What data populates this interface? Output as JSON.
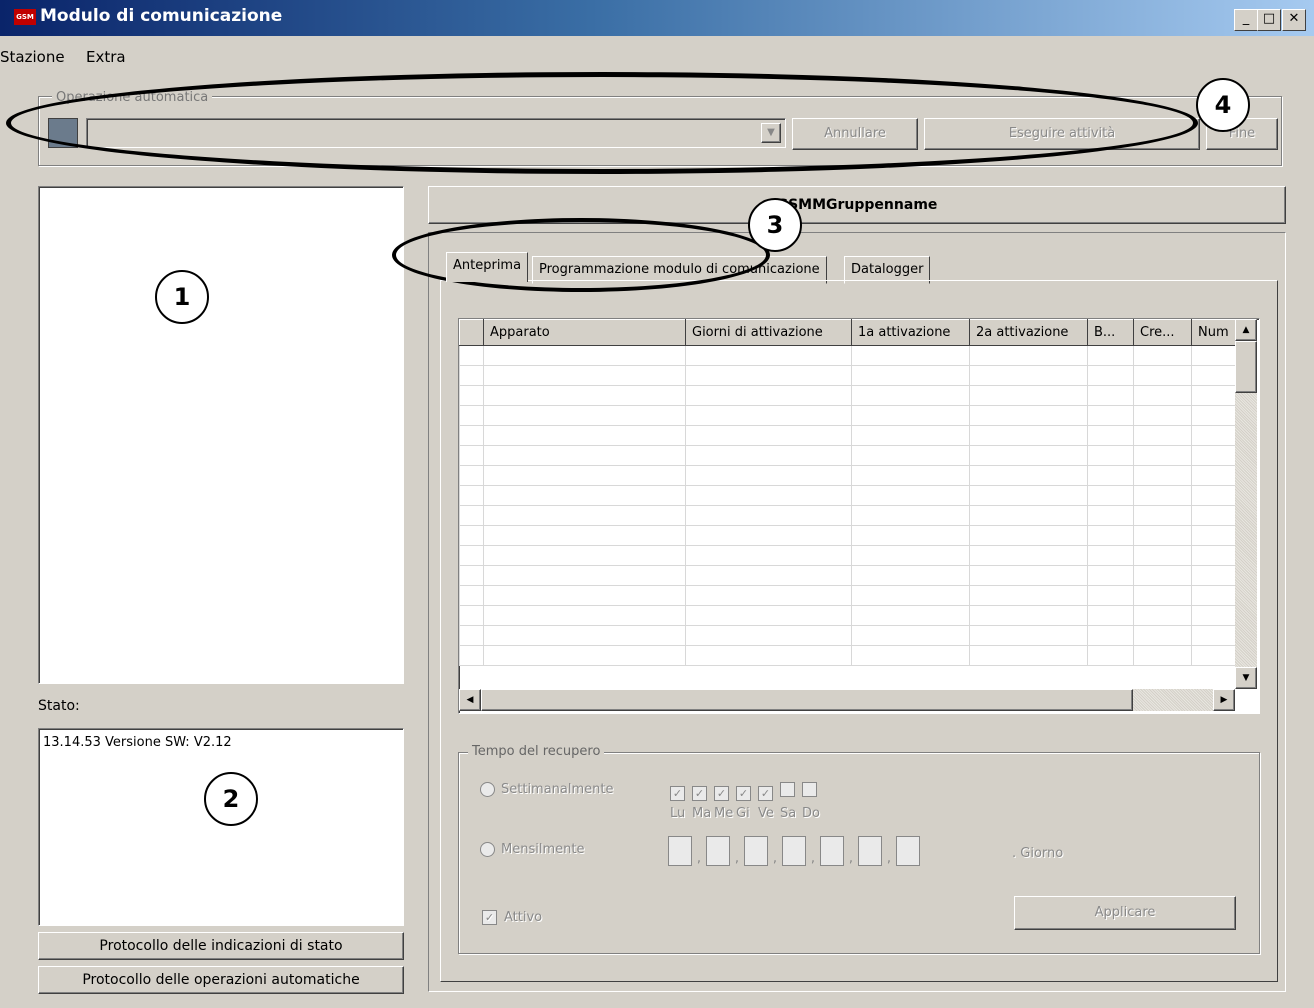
{
  "window": {
    "title": "Modulo di comunicazione",
    "icon_text": "GSM",
    "buttons": {
      "minimize": "_",
      "maximize": "□",
      "close": "✕"
    }
  },
  "menu": [
    "Stazione",
    "Extra"
  ],
  "auto_op": {
    "group_label": "Operazione automatica",
    "cancel_label": "Annullare",
    "execute_label": "Eseguire attività",
    "end_label": "Fine",
    "dropdown_value": ""
  },
  "left": {
    "status_label": "Stato:",
    "status_lines": [
      "13.14.53 Versione SW: V2.12"
    ],
    "btn_status_log": "Protocollo delle indicazioni di stato",
    "btn_auto_log": "Protocollo delle operazioni automatiche"
  },
  "right": {
    "group_name": "GSMMGruppenname",
    "tabs": [
      "Anteprima",
      "Programmazione modulo di comunicazione",
      "Datalogger"
    ],
    "active_tab": 0,
    "columns": [
      "",
      "Apparato",
      "Giorni di attivazione",
      "1a attivazione",
      "2a attivazione",
      "B...",
      "Cre...",
      "Num"
    ],
    "row_count": 16
  },
  "recovery": {
    "group_label": "Tempo del recupero",
    "weekly_label": "Settimanalmente",
    "monthly_label": "Mensilmente",
    "days": [
      "Lu",
      "Ma",
      "Me",
      "Gi",
      "Ve",
      "Sa",
      "Do"
    ],
    "days_checked": [
      true,
      true,
      true,
      true,
      true,
      false,
      false
    ],
    "giorno_label": ". Giorno",
    "attivo_label": "Attivo",
    "attivo_checked": true,
    "apply_label": "Applicare"
  },
  "annotations": [
    "1",
    "2",
    "3",
    "4"
  ]
}
